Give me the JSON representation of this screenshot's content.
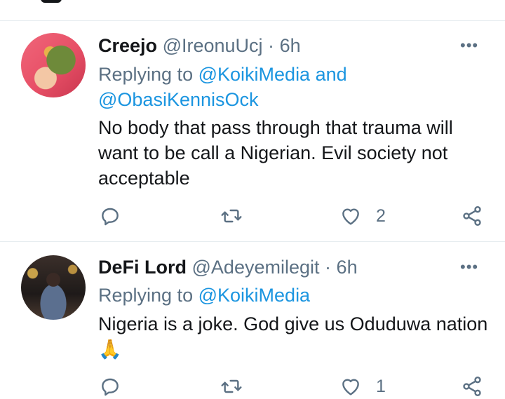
{
  "tweets": [
    {
      "name": "Creejo",
      "handle": "@IreonuUcj",
      "separator": "·",
      "time": "6h",
      "replying_prefix": "Replying to",
      "replying_to_1": "@KoikiMedia",
      "replying_and": "and",
      "replying_to_2": "@ObasiKennisOck",
      "text": "No body that pass through that trauma will want to be call a Nigerian. Evil society not acceptable",
      "like_count": "2",
      "more_label": "•••"
    },
    {
      "name": "DeFi Lord",
      "handle": "@Adeyemilegit",
      "separator": "·",
      "time": "6h",
      "replying_prefix": "Replying to",
      "replying_to_1": "@KoikiMedia",
      "text": "Nigeria is a joke. God give us Oduduwa nation",
      "emoji": "🙏",
      "like_count": "1",
      "more_label": "•••"
    }
  ],
  "icons": [
    "reply-icon",
    "retweet-icon",
    "like-icon",
    "share-icon",
    "more-icon"
  ],
  "colors": {
    "link": "#1b95e0",
    "muted": "#5b7083",
    "text": "#141619",
    "divider": "#e6ecf0"
  }
}
